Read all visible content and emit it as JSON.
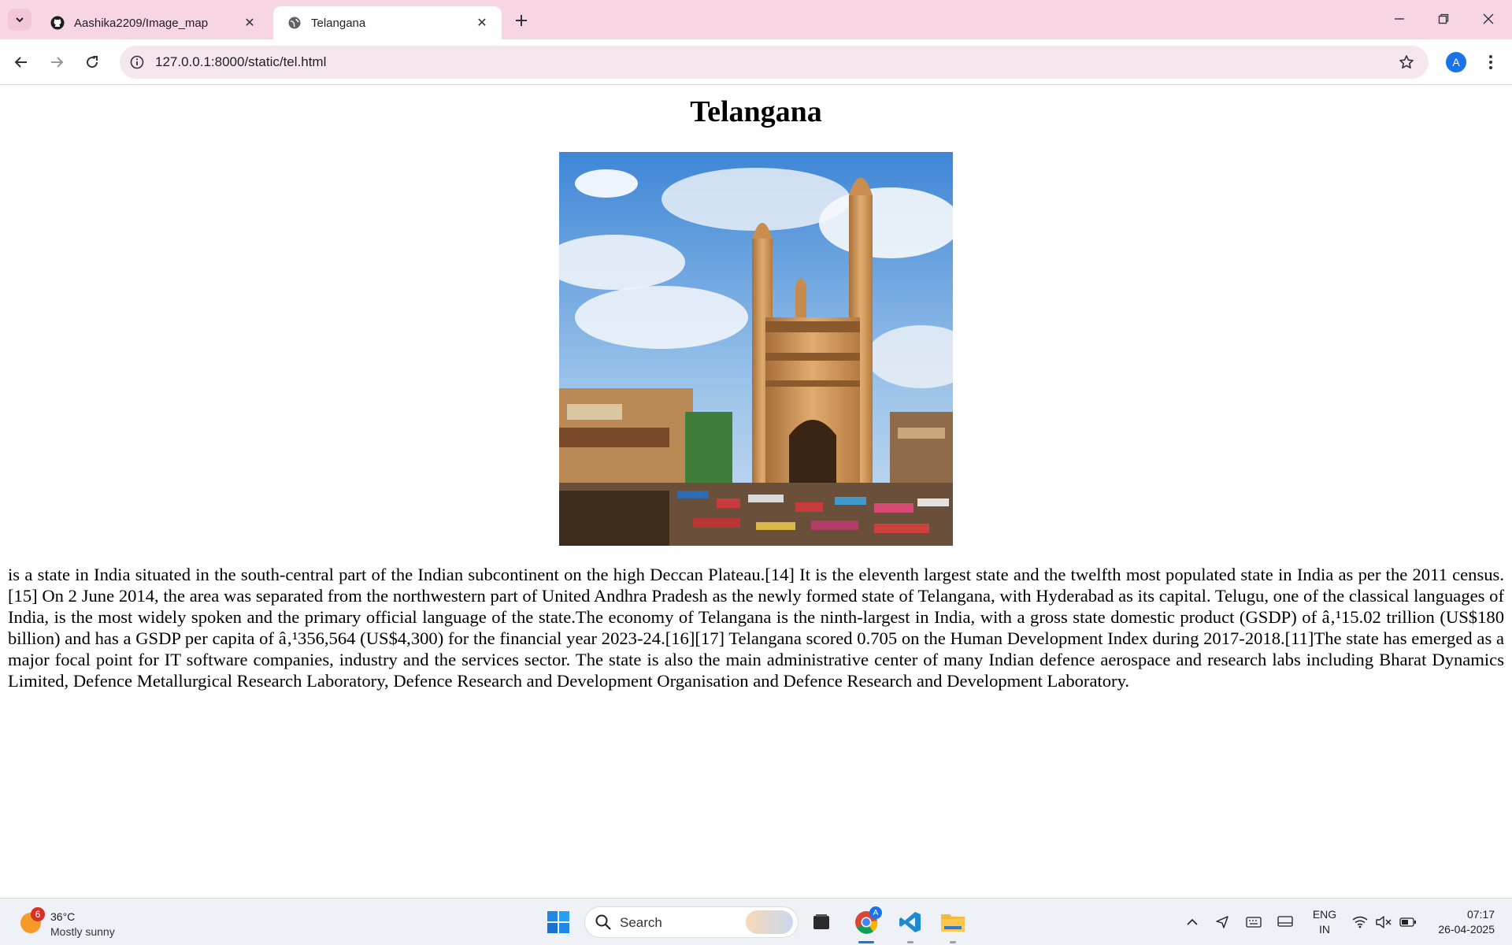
{
  "browser": {
    "tabs": [
      {
        "title": "Aashika2209/Image_map",
        "favicon": "github-icon",
        "active": false
      },
      {
        "title": "Telangana",
        "favicon": "globe-icon",
        "active": true
      }
    ],
    "url": "127.0.0.1:8000/static/tel.html",
    "profile_initial": "A"
  },
  "page": {
    "heading": "Telangana",
    "image_alt": "Charminar",
    "body_text": "is a state in India situated in the south-central part of the Indian subcontinent on the high Deccan Plateau.[14] It is the eleventh largest state and the twelfth most populated state in India as per the 2011 census.[15] On 2 June 2014, the area was separated from the northwestern part of United Andhra Pradesh as the newly formed state of Telangana, with Hyderabad as its capital. Telugu, one of the classical languages of India, is the most widely spoken and the primary official language of the state.The economy of Telangana is the ninth-largest in India, with a gross state domestic product (GSDP) of â‚¹15.02 trillion (US$180 billion) and has a GSDP per capita of â‚¹356,564 (US$4,300) for the financial year 2023-24.[16][17] Telangana scored 0.705 on the Human Development Index during 2017-2018.[11]The state has emerged as a major focal point for IT software companies, industry and the services sector. The state is also the main administrative center of many Indian defence aerospace and research labs including Bharat Dynamics Limited, Defence Metallurgical Research Laboratory, Defence Research and Development Organisation and Defence Research and Development Laboratory."
  },
  "taskbar": {
    "weather": {
      "badge": "6",
      "temp": "36°C",
      "condition": "Mostly sunny"
    },
    "search_label": "Search",
    "lang_line1": "ENG",
    "lang_line2": "IN",
    "time": "07:17",
    "date": "26-04-2025",
    "chrome_badge": "A"
  },
  "colors": {
    "tabstrip": "#f8d5e3",
    "omnibox": "#f6e6ee",
    "taskbar": "#eef1f6"
  }
}
